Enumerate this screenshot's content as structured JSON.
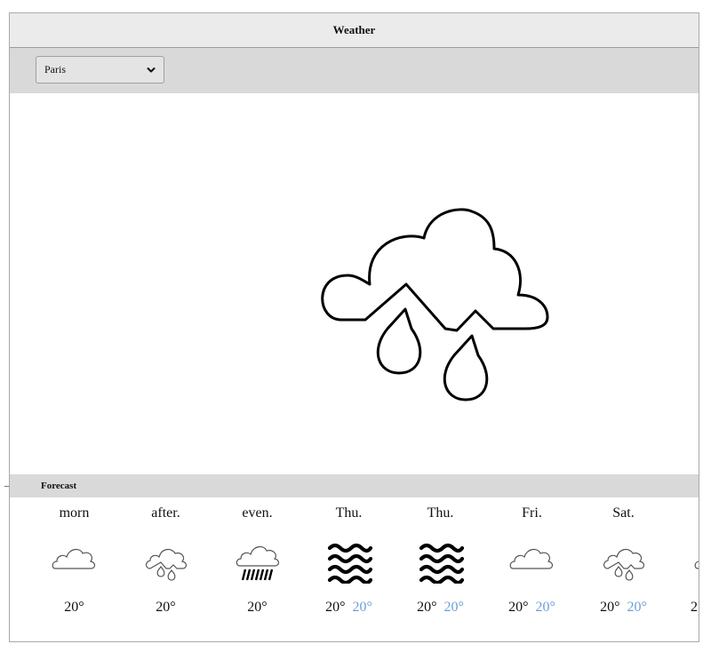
{
  "window": {
    "title": "Weather"
  },
  "toolbar": {
    "city_select": {
      "value": "Paris"
    }
  },
  "current": {
    "icon": "cloud-storm-rain-icon"
  },
  "forecast": {
    "header": "Forecast",
    "items": [
      {
        "label": "morn",
        "icon": "cloud-icon",
        "temp": "20°",
        "temp2": ""
      },
      {
        "label": "after.",
        "icon": "cloud-storm-rain-icon",
        "temp": "20°",
        "temp2": ""
      },
      {
        "label": "even.",
        "icon": "cloud-heavy-rain-icon",
        "temp": "20°",
        "temp2": ""
      },
      {
        "label": "Thu.",
        "icon": "waves-icon",
        "temp": "20°",
        "temp2": "20°"
      },
      {
        "label": "Thu.",
        "icon": "waves-icon",
        "temp": "20°",
        "temp2": "20°"
      },
      {
        "label": "Fri.",
        "icon": "cloud-icon",
        "temp": "20°",
        "temp2": "20°"
      },
      {
        "label": "Sat.",
        "icon": "cloud-storm-rain-icon",
        "temp": "20°",
        "temp2": "20°"
      },
      {
        "label": "",
        "icon": "cloud-icon",
        "temp": "2",
        "temp2": ""
      }
    ]
  },
  "colors": {
    "hi_temp": "#6a9fd6",
    "bar": "#d9d9d9",
    "titlebar": "#ebebeb"
  }
}
